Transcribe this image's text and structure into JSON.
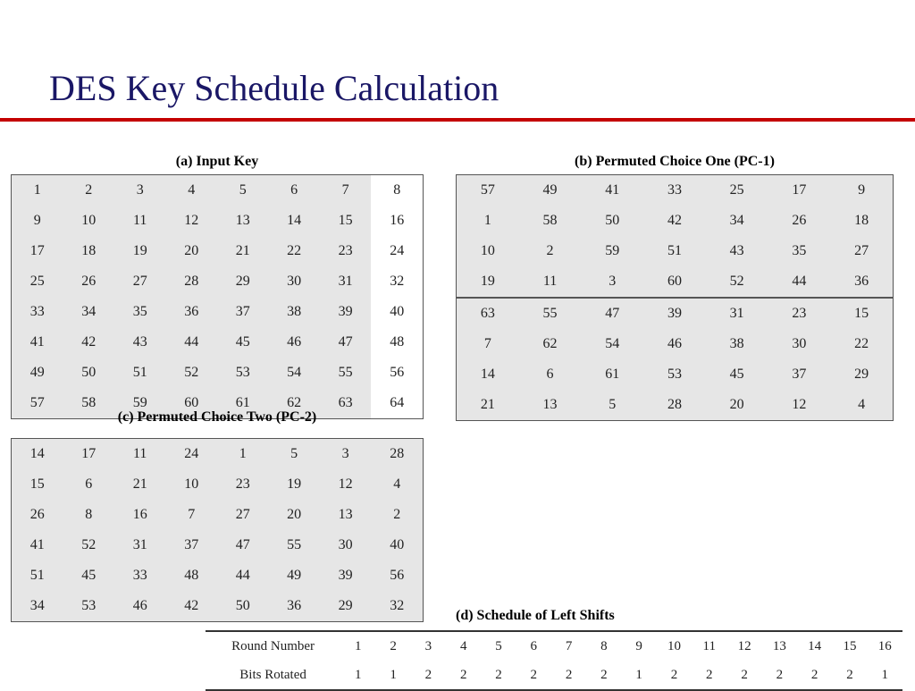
{
  "title": "DES Key Schedule Calculation",
  "captions": {
    "a": "(a) Input Key",
    "b": "(b) Permuted Choice One (PC-1)",
    "c": "(c) Permuted Choice Two (PC-2)",
    "d": "(d) Schedule of Left Shifts"
  },
  "chart_data": [
    {
      "type": "table",
      "title": "(a) Input Key",
      "rows": [
        [
          1,
          2,
          3,
          4,
          5,
          6,
          7,
          8
        ],
        [
          9,
          10,
          11,
          12,
          13,
          14,
          15,
          16
        ],
        [
          17,
          18,
          19,
          20,
          21,
          22,
          23,
          24
        ],
        [
          25,
          26,
          27,
          28,
          29,
          30,
          31,
          32
        ],
        [
          33,
          34,
          35,
          36,
          37,
          38,
          39,
          40
        ],
        [
          41,
          42,
          43,
          44,
          45,
          46,
          47,
          48
        ],
        [
          49,
          50,
          51,
          52,
          53,
          54,
          55,
          56
        ],
        [
          57,
          58,
          59,
          60,
          61,
          62,
          63,
          64
        ]
      ]
    },
    {
      "type": "table",
      "title": "(b) Permuted Choice One (PC-1)",
      "rows": [
        [
          57,
          49,
          41,
          33,
          25,
          17,
          9
        ],
        [
          1,
          58,
          50,
          42,
          34,
          26,
          18
        ],
        [
          10,
          2,
          59,
          51,
          43,
          35,
          27
        ],
        [
          19,
          11,
          3,
          60,
          52,
          44,
          36
        ],
        [
          63,
          55,
          47,
          39,
          31,
          23,
          15
        ],
        [
          7,
          62,
          54,
          46,
          38,
          30,
          22
        ],
        [
          14,
          6,
          61,
          53,
          45,
          37,
          29
        ],
        [
          21,
          13,
          5,
          28,
          20,
          12,
          4
        ]
      ]
    },
    {
      "type": "table",
      "title": "(c) Permuted Choice Two (PC-2)",
      "rows": [
        [
          14,
          17,
          11,
          24,
          1,
          5,
          3,
          28
        ],
        [
          15,
          6,
          21,
          10,
          23,
          19,
          12,
          4
        ],
        [
          26,
          8,
          16,
          7,
          27,
          20,
          13,
          2
        ],
        [
          41,
          52,
          31,
          37,
          47,
          55,
          30,
          40
        ],
        [
          51,
          45,
          33,
          48,
          44,
          49,
          39,
          56
        ],
        [
          34,
          53,
          46,
          42,
          50,
          36,
          29,
          32
        ]
      ]
    },
    {
      "type": "table",
      "title": "(d) Schedule of Left Shifts",
      "row_labels": [
        "Round Number",
        "Bits Rotated"
      ],
      "rows": [
        [
          1,
          2,
          3,
          4,
          5,
          6,
          7,
          8,
          9,
          10,
          11,
          12,
          13,
          14,
          15,
          16
        ],
        [
          1,
          1,
          2,
          2,
          2,
          2,
          2,
          2,
          1,
          2,
          2,
          2,
          2,
          2,
          2,
          1
        ]
      ]
    }
  ]
}
